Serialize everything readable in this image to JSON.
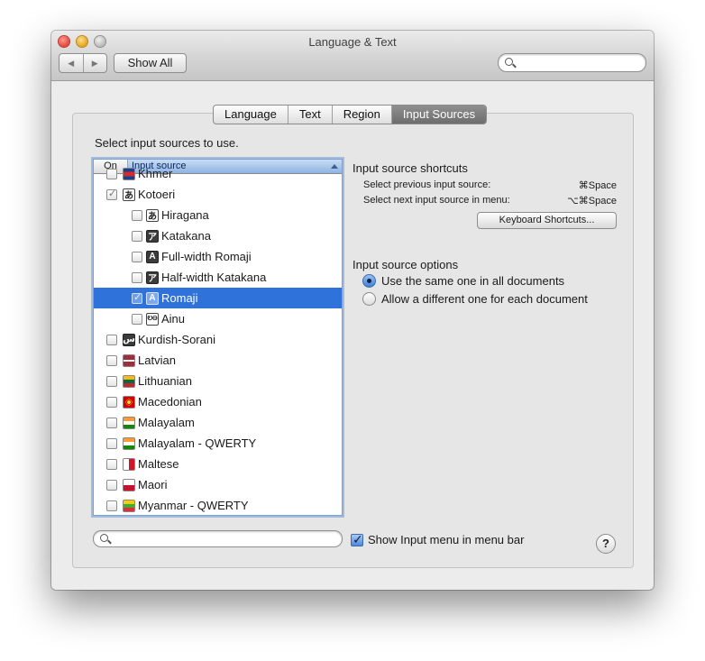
{
  "window": {
    "title": "Language & Text",
    "nav_back": "◀",
    "nav_forward": "▶",
    "show_all": "Show All",
    "search_value": ""
  },
  "tabs": [
    {
      "label": "Language",
      "selected": false
    },
    {
      "label": "Text",
      "selected": false
    },
    {
      "label": "Region",
      "selected": false
    },
    {
      "label": "Input Sources",
      "selected": true
    }
  ],
  "input_sources": {
    "instruction": "Select input sources to use.",
    "header_on": "On",
    "header_source": "Input source",
    "rows": [
      {
        "label": "Khmer",
        "icon": "khmer-flag-icon",
        "icon_text": "",
        "checked": false,
        "sub": false,
        "selected": false
      },
      {
        "label": "Kotoeri",
        "icon": "hiragana-a-icon",
        "icon_text": "あ",
        "checked": true,
        "sub": false,
        "selected": false
      },
      {
        "label": "Hiragana",
        "icon": "hiragana-a-icon",
        "icon_text": "あ",
        "checked": false,
        "sub": true,
        "selected": false
      },
      {
        "label": "Katakana",
        "icon": "katakana-a-icon",
        "icon_text": "ア",
        "checked": false,
        "sub": true,
        "selected": false
      },
      {
        "label": "Full-width Romaji",
        "icon": "fullwidth-a-icon",
        "icon_text": "A",
        "checked": false,
        "sub": true,
        "selected": false
      },
      {
        "label": "Half-width Katakana",
        "icon": "halfwidth-katakana-icon",
        "icon_text": "ア",
        "checked": false,
        "sub": true,
        "selected": false
      },
      {
        "label": "Romaji",
        "icon": "romaji-a-icon",
        "icon_text": "A",
        "checked": true,
        "sub": true,
        "selected": true
      },
      {
        "label": "Ainu",
        "icon": "ainu-icon",
        "icon_text": "ᎧᎾ",
        "checked": false,
        "sub": true,
        "selected": false
      },
      {
        "label": "Kurdish-Sorani",
        "icon": "sorani-script-icon",
        "icon_text": "س",
        "checked": false,
        "sub": false,
        "selected": false
      },
      {
        "label": "Latvian",
        "icon": "latvia-flag-icon",
        "icon_text": "",
        "checked": false,
        "sub": false,
        "selected": false
      },
      {
        "label": "Lithuanian",
        "icon": "lithuania-flag-icon",
        "icon_text": "",
        "checked": false,
        "sub": false,
        "selected": false
      },
      {
        "label": "Macedonian",
        "icon": "macedonia-flag-icon",
        "icon_text": "",
        "checked": false,
        "sub": false,
        "selected": false
      },
      {
        "label": "Malayalam",
        "icon": "malayalam-india-flag-icon",
        "icon_text": "",
        "checked": false,
        "sub": false,
        "selected": false
      },
      {
        "label": "Malayalam - QWERTY",
        "icon": "malayalam-qwerty-flag-icon",
        "icon_text": "",
        "checked": false,
        "sub": false,
        "selected": false
      },
      {
        "label": "Maltese",
        "icon": "malta-flag-icon",
        "icon_text": "",
        "checked": false,
        "sub": false,
        "selected": false
      },
      {
        "label": "Maori",
        "icon": "maori-flag-icon",
        "icon_text": "",
        "checked": false,
        "sub": false,
        "selected": false
      },
      {
        "label": "Myanmar - QWERTY",
        "icon": "myanmar-flag-icon",
        "icon_text": "",
        "checked": false,
        "sub": false,
        "selected": false
      }
    ],
    "filter_value": ""
  },
  "shortcuts": {
    "title": "Input source shortcuts",
    "prev_label": "Select previous input source:",
    "prev_key": "⌘Space",
    "next_label": "Select next input source in menu:",
    "next_key": "⌥⌘Space",
    "button": "Keyboard Shortcuts..."
  },
  "options": {
    "title": "Input source options",
    "same_label": "Use the same one in all documents",
    "different_label": "Allow a different one for each document",
    "selected": "same"
  },
  "show_input_menu": {
    "label": "Show Input menu in menu bar",
    "checked": true
  },
  "help": "?",
  "colors": {
    "selection": "#2f72d9",
    "window_bg": "#ececec"
  }
}
